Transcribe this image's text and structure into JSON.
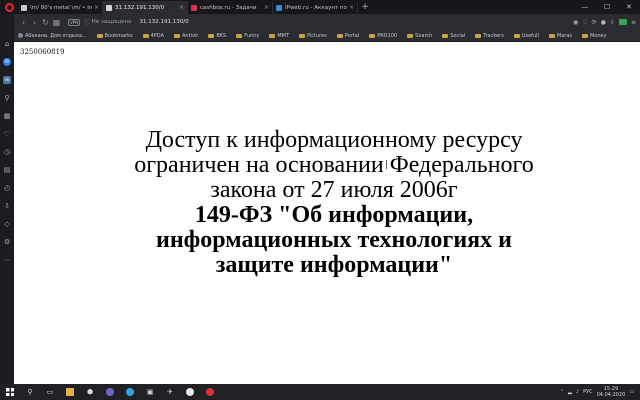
{
  "browser": {
    "tabs": [
      {
        "title": "\\m/ 80's metal \\m/ • Index",
        "fav_color": "#c9c9c9"
      },
      {
        "title": "31.132.191.130/0",
        "fav_color": "#d6d6d6",
        "active": true
      },
      {
        "title": "cashbox.ru - Задачи",
        "fav_color": "#e0304a"
      },
      {
        "title": "IPweb.ru - Аккаунт пользо...",
        "fav_color": "#3d86d8"
      }
    ],
    "new_tab": "+",
    "address": {
      "vpn": "VPN",
      "security": "Не защищено",
      "url": "31.132.191.130/0"
    },
    "bookmarks": [
      {
        "label": "Абакана. Дом отдыха...",
        "type": "page"
      },
      {
        "label": "Bookmarks",
        "type": "folder"
      },
      {
        "label": "4PDA",
        "type": "folder"
      },
      {
        "label": "Antivir",
        "type": "folder"
      },
      {
        "label": "BKS",
        "type": "folder"
      },
      {
        "label": "Funny",
        "type": "folder"
      },
      {
        "label": "MMT",
        "type": "folder"
      },
      {
        "label": "Pictures",
        "type": "folder"
      },
      {
        "label": "Portal",
        "type": "folder"
      },
      {
        "label": "PRO100",
        "type": "folder"
      },
      {
        "label": "Search",
        "type": "folder"
      },
      {
        "label": "Social",
        "type": "folder"
      },
      {
        "label": "Trackers",
        "type": "folder"
      },
      {
        "label": "Usefull",
        "type": "folder"
      },
      {
        "label": "Maras",
        "type": "folder"
      },
      {
        "label": "Money",
        "type": "folder"
      }
    ]
  },
  "page": {
    "id_text": "3250060819",
    "notice_main": "Доступ к информационному ресурсу ограничен на основании Федерального закона от 27 июля 2006г",
    "notice_law": "149-ФЗ \"Об информации, информационных технологиях и защите информации\""
  },
  "taskbar": {
    "lang": "РУС",
    "time": "15:29",
    "date": "04.04.2020"
  }
}
